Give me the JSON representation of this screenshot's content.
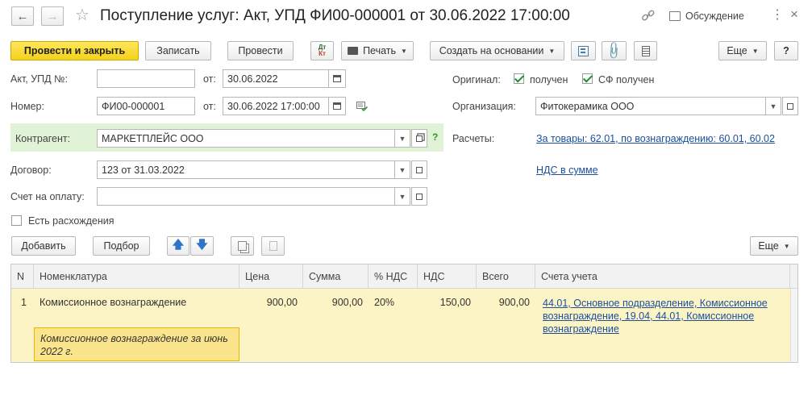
{
  "header": {
    "title": "Поступление услуг: Акт, УПД ФИ00-000001 от 30.06.2022 17:00:00",
    "discuss_label": "Обсуждение"
  },
  "toolbar": {
    "post_close": "Провести и закрыть",
    "save": "Записать",
    "post": "Провести",
    "dtkt_top": "Дт",
    "dtkt_bottom": "Кт",
    "print": "Печать",
    "create_based": "Создать на основании",
    "more": "Еще",
    "help": "?"
  },
  "form": {
    "act_label": "Акт, УПД №:",
    "act_value": "",
    "act_from_label": "от:",
    "act_date": "30.06.2022",
    "number_label": "Номер:",
    "number_value": "ФИ00-000001",
    "number_from_label": "от:",
    "number_date": "30.06.2022 17:00:00",
    "counterparty_label": "Контрагент:",
    "counterparty_value": "МАРКЕТПЛЕЙС ООО",
    "counterparty_help": "?",
    "contract_label": "Договор:",
    "contract_value": "123 от 31.03.2022",
    "invoice_label": "Счет на оплату:",
    "invoice_value": "",
    "discrepancy_label": "Есть расхождения",
    "original_label": "Оригинал:",
    "received_label": "получен",
    "sf_received_label": "СФ получен",
    "org_label": "Организация:",
    "org_value": "Фитокерамика ООО",
    "settlements_label": "Расчеты:",
    "settlements_link": "За товары: 62.01, по вознаграждению: 60.01, 60.02",
    "vat_link": "НДС в сумме"
  },
  "table_toolbar": {
    "add": "Добавить",
    "pick": "Подбор",
    "more": "Еще"
  },
  "table": {
    "columns": [
      "N",
      "Номенклатура",
      "Цена",
      "Сумма",
      "% НДС",
      "НДС",
      "Всего",
      "Счета учета"
    ],
    "rows": [
      {
        "n": "1",
        "item": "Комиссионное вознаграждение",
        "price": "900,00",
        "sum": "900,00",
        "vat_rate": "20%",
        "vat": "150,00",
        "total": "900,00",
        "accounts": "44.01, Основное подразделение, Комиссионное вознаграждение, 19.04, 44.01, Комиссионное вознаграждение",
        "content": "Комиссионное вознаграждение за июнь 2022 г."
      }
    ]
  },
  "colors": {
    "primary_button": "#f5d21b",
    "counterparty_highlight": "#e0f3d6",
    "row_highlight": "#fdf4c5",
    "link": "#1b4f9c"
  }
}
